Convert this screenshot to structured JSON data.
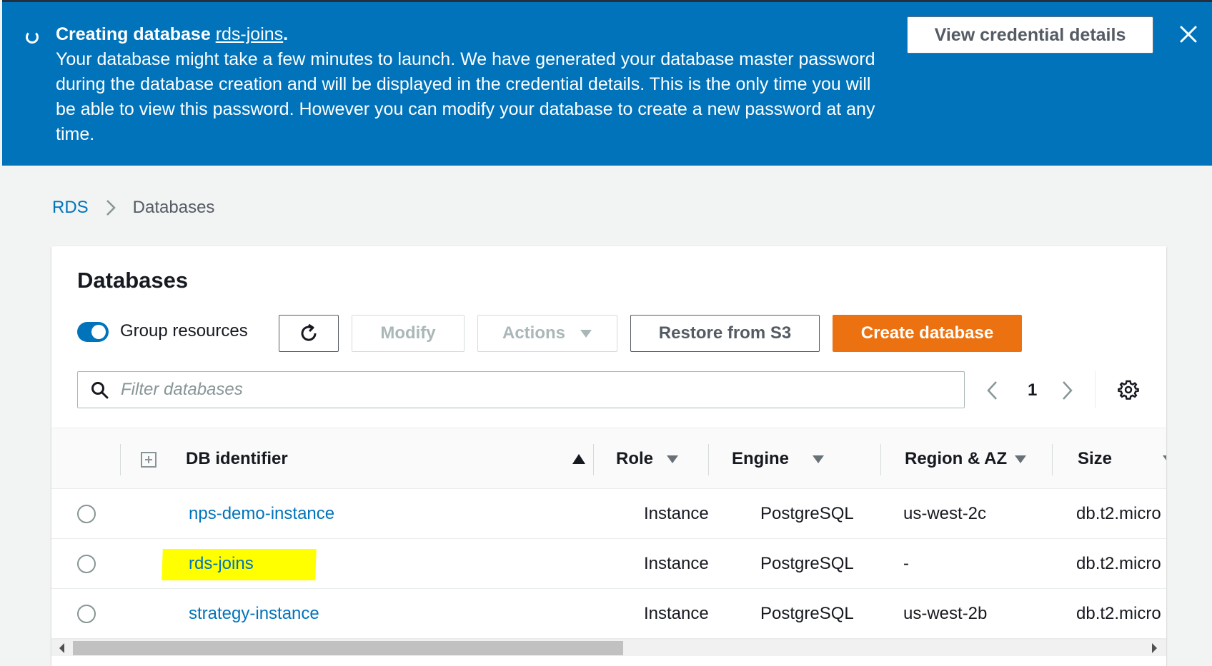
{
  "banner": {
    "title_prefix": "Creating database ",
    "title_link": "rds-joins",
    "title_suffix": ".",
    "message": "Your database might take a few minutes to launch. We have generated your database master password during the database creation and will be displayed in the credential details. This is the only time you will be able to view this password. However you can modify your database to create a new password at any time.",
    "view_credentials_label": "View credential details",
    "spinner_icon": "loading-spinner-icon",
    "close_icon": "close-icon"
  },
  "breadcrumb": {
    "root": "RDS",
    "current": "Databases"
  },
  "panel": {
    "title": "Databases",
    "group_resources_label": "Group resources",
    "group_resources_on": true,
    "buttons": {
      "modify": "Modify",
      "actions": "Actions",
      "restore": "Restore from S3",
      "create": "Create database"
    },
    "search_placeholder": "Filter databases",
    "page_number": "1"
  },
  "table": {
    "columns": {
      "db_identifier": "DB identifier",
      "role": "Role",
      "engine": "Engine",
      "region_az": "Region & AZ",
      "size": "Size"
    },
    "rows": [
      {
        "id": "nps-demo-instance",
        "role": "Instance",
        "engine": "PostgreSQL",
        "region": "us-west-2c",
        "size": "db.t2.micro"
      },
      {
        "id": "rds-joins",
        "role": "Instance",
        "engine": "PostgreSQL",
        "region": "-",
        "size": "db.t2.micro"
      },
      {
        "id": "strategy-instance",
        "role": "Instance",
        "engine": "PostgreSQL",
        "region": "us-west-2b",
        "size": "db.t2.micro"
      }
    ]
  },
  "colors": {
    "banner_blue": "#0073bb",
    "primary_orange": "#ec7211",
    "link_blue": "#0073bb",
    "highlight_yellow": "#ffff00"
  }
}
